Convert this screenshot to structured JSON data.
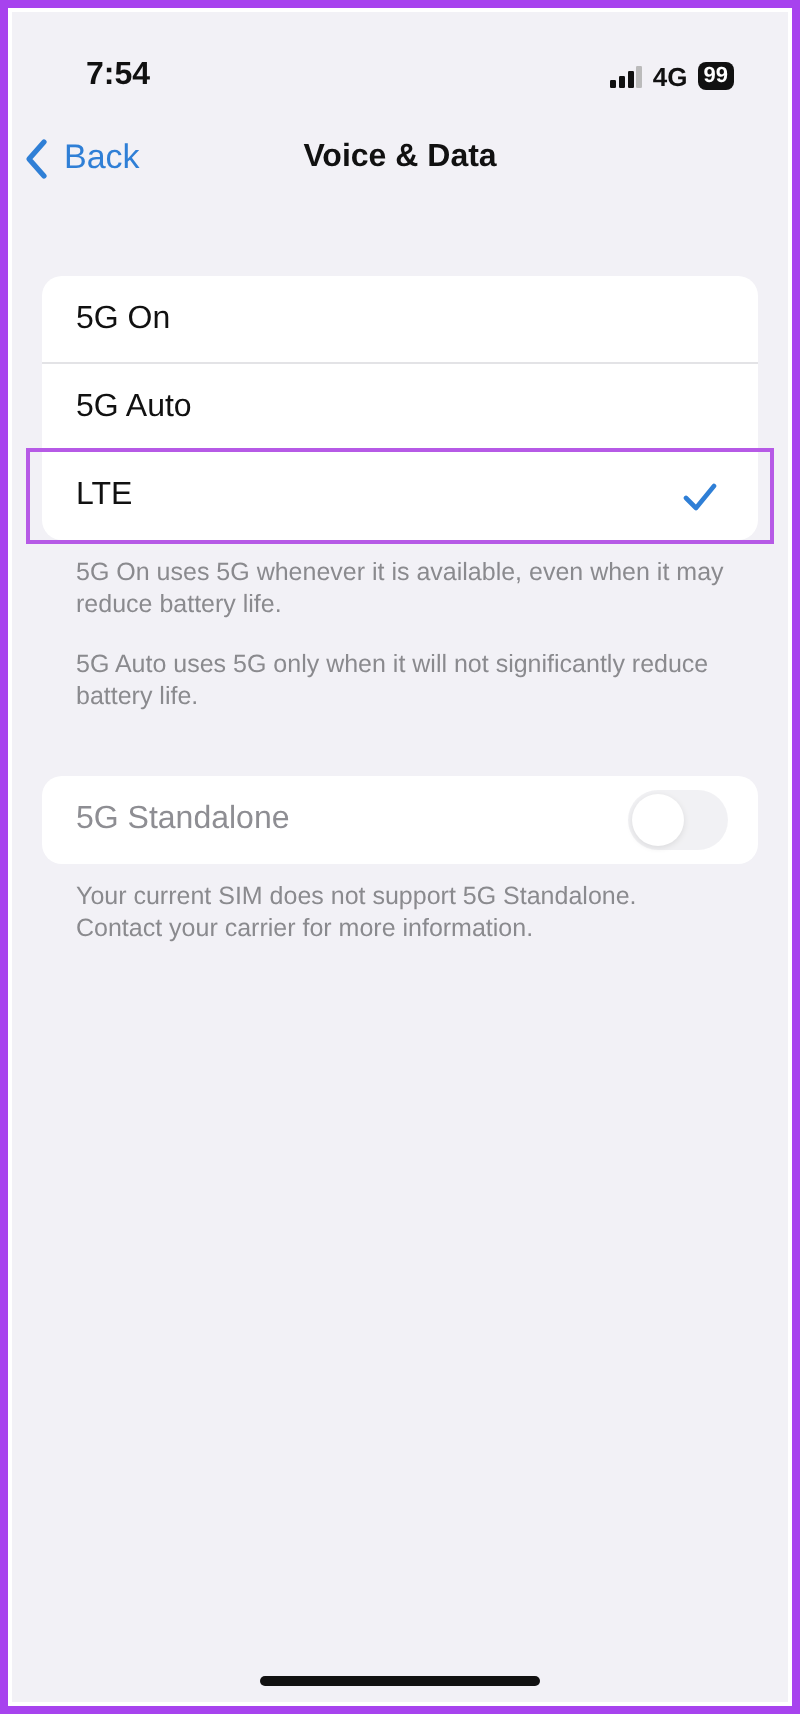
{
  "status_bar": {
    "time": "7:54",
    "network": "4G",
    "battery": "99"
  },
  "nav": {
    "back": "Back",
    "title": "Voice & Data"
  },
  "options": [
    {
      "label": "5G On",
      "selected": false,
      "highlighted": false
    },
    {
      "label": "5G Auto",
      "selected": false,
      "highlighted": false
    },
    {
      "label": "LTE",
      "selected": true,
      "highlighted": true
    }
  ],
  "options_footer": [
    "5G On uses 5G whenever it is available, even when it may reduce battery life.",
    "5G Auto uses 5G only when it will not significantly reduce battery life."
  ],
  "standalone": {
    "label": "5G Standalone",
    "on": false,
    "disabled": true
  },
  "standalone_footer": "Your current SIM does not support 5G Standalone. Contact your carrier for more information."
}
